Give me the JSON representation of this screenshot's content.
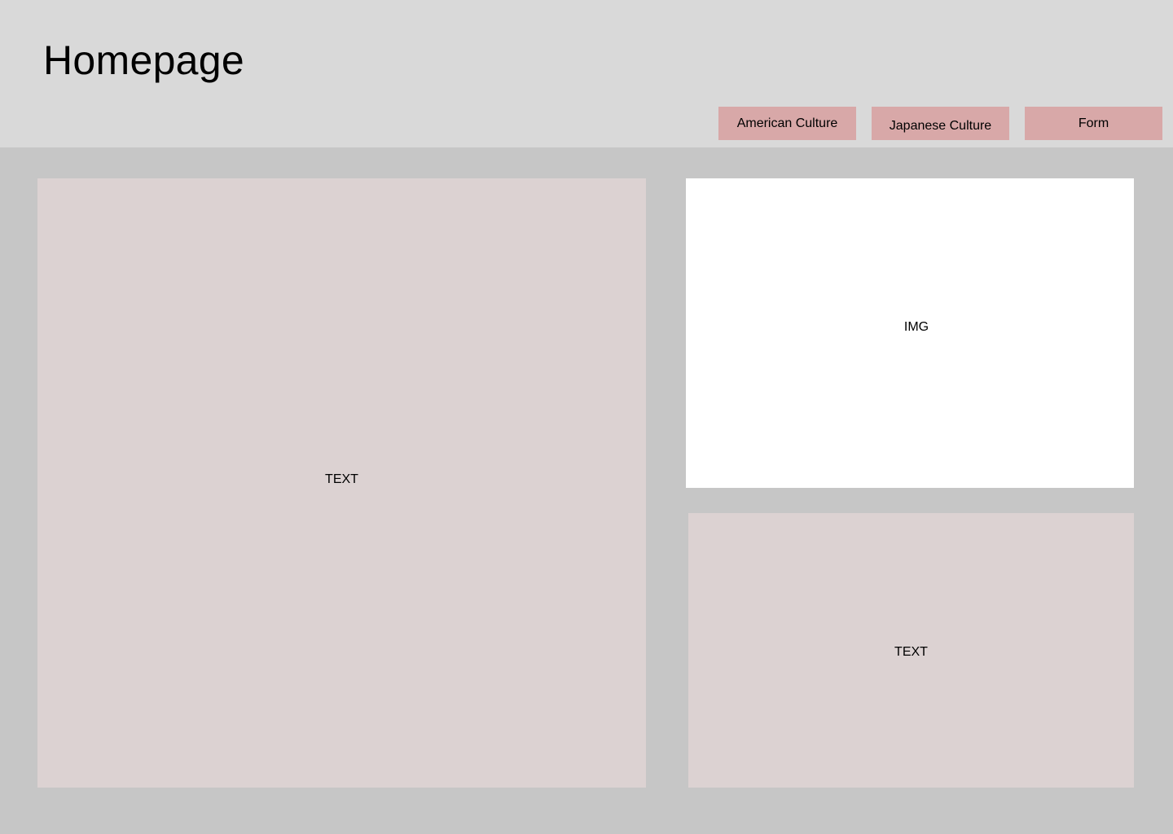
{
  "header": {
    "title": "Homepage",
    "background": "#d9d9d9"
  },
  "nav": {
    "items": [
      {
        "label": "American Culture"
      },
      {
        "label": "Japanese Culture"
      },
      {
        "label": "Form"
      }
    ],
    "button_color": "#d8a8a8"
  },
  "content": {
    "main_text": "TEXT",
    "image_label": "IMG",
    "side_text": "TEXT"
  },
  "colors": {
    "page_background": "#c6c6c6",
    "panel_background": "#dcd2d2",
    "image_background": "#ffffff"
  }
}
